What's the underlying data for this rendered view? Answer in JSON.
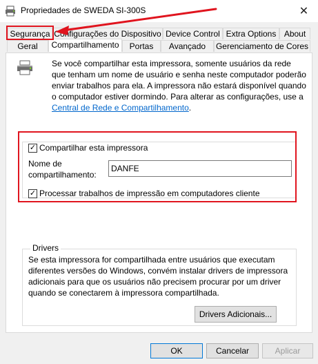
{
  "window": {
    "title": "Propriedades de SWEDA SI-300S",
    "close_glyph": "✕"
  },
  "tabs_back": [
    {
      "label": "Segurança"
    },
    {
      "label": "Configurações do Dispositivo"
    },
    {
      "label": "Device Control"
    },
    {
      "label": "Extra Options"
    },
    {
      "label": "About"
    }
  ],
  "tabs_front": [
    {
      "label": "Geral"
    },
    {
      "label": "Compartilhamento",
      "selected": true
    },
    {
      "label": "Portas"
    },
    {
      "label": "Avançado"
    },
    {
      "label": "Gerenciamento de Cores"
    }
  ],
  "info": {
    "text": "Se você compartilhar esta impressora, somente usuários da rede que tenham um nome de usuário e senha neste computador poderão enviar trabalhos para ela. A impressora não estará disponível quando o computador estiver dormindo. Para alterar as configurações, use a",
    "link": "Central de Rede e Compartilhamento",
    "link_suffix": "."
  },
  "share": {
    "share_checkbox_label": "Compartilhar esta impressora",
    "share_checked": true,
    "share_name_label_line1": "Nome de",
    "share_name_label_line2": "compartilhamento:",
    "share_name_value": "DANFE",
    "render_checkbox_label": "Processar trabalhos de impressão em computadores cliente",
    "render_checked": true
  },
  "drivers": {
    "legend": "Drivers",
    "text": "Se esta impressora for compartilhada entre usuários que executam diferentes versões do Windows, convém instalar drivers de impressora adicionais para que os usuários não precisem procurar por um driver quando se conectarem à impressora compartilhada.",
    "button_label": "Drivers Adicionais..."
  },
  "buttons": {
    "ok": "OK",
    "cancel": "Cancelar",
    "apply": "Aplicar"
  },
  "colors": {
    "annotation_red": "#e0141e",
    "link_blue": "#0066cc"
  }
}
